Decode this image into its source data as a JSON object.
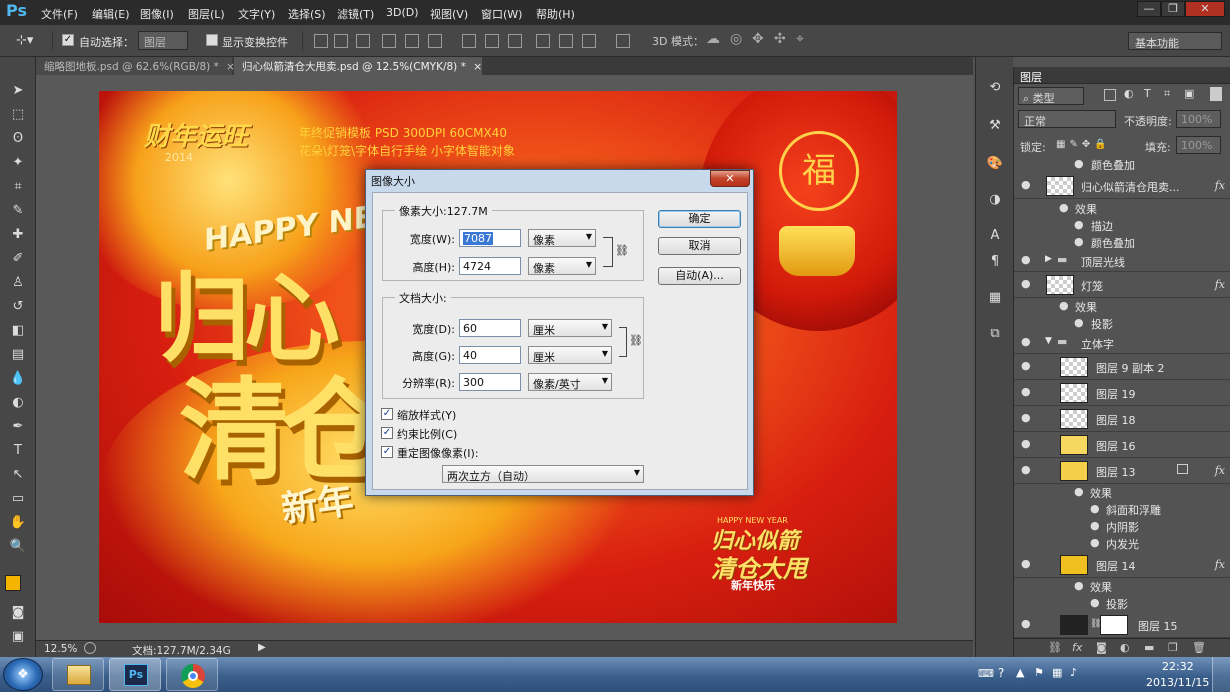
{
  "app": {
    "logo": "Ps"
  },
  "menu": [
    "文件(F)",
    "编辑(E)",
    "图像(I)",
    "图层(L)",
    "文字(Y)",
    "选择(S)",
    "滤镜(T)",
    "3D(D)",
    "视图(V)",
    "窗口(W)",
    "帮助(H)"
  ],
  "window_controls": {
    "minimize": "—",
    "restore": "❐",
    "close": "✕"
  },
  "options": {
    "auto_select_label": "自动选择：",
    "auto_select_value": "图层",
    "show_transform_label": "显示变换控件",
    "mode_3d_label": "3D 模式：",
    "workspace": "基本功能"
  },
  "tabs": [
    {
      "label": "缩略图地板.psd @ 62.6%(RGB/8) *",
      "close": "×"
    },
    {
      "label": "归心似箭清仓大甩卖.psd @ 12.5%(CMYK/8) *",
      "close": "×"
    }
  ],
  "poster": {
    "logo_text": "财年运旺",
    "year": "2014",
    "promo_line1": "年终促销模板 PSD 300DPI   60CMX40",
    "promo_line2": "花朵\\灯笼\\字体自行手绘 小字体智能对象",
    "happy_new": "HAPPY NEW",
    "big_char1": "归心",
    "big_char2": "清仓",
    "new_year": "新年",
    "lantern_char": "福",
    "small_hny": "HAPPY NEW YEAR",
    "small_title1": "归心似箭",
    "small_title2": "清仓大甩",
    "small_newyear": "新年快乐"
  },
  "status": {
    "zoom": "12.5%",
    "doc": "文档:127.7M/2.34G"
  },
  "colors": {
    "foreground": "#f5b400",
    "background": "#ffffff",
    "selected_field": "#3a78d6"
  },
  "dialog": {
    "title": "图像大小",
    "close": "✕",
    "pixel_size_label": "像素大小:127.7M",
    "width_label": "宽度(W):",
    "width_value": "7087",
    "width_unit": "像素",
    "height_label": "高度(H):",
    "height_value": "4724",
    "height_unit": "像素",
    "doc_size_label": "文档大小:",
    "doc_width_label": "宽度(D):",
    "doc_width_value": "60",
    "doc_width_unit": "厘米",
    "doc_height_label": "高度(G):",
    "doc_height_value": "40",
    "doc_height_unit": "厘米",
    "resolution_label": "分辨率(R):",
    "resolution_value": "300",
    "resolution_unit": "像素/英寸",
    "scale_styles": "缩放样式(Y)",
    "constrain": "约束比例(C)",
    "resample": "重定图像像素(I):",
    "resample_method": "两次立方（自动）",
    "ok": "确定",
    "cancel": "取消",
    "auto": "自动(A)..."
  },
  "layers": {
    "panel_title": "图层",
    "kind_filter": "类型",
    "blend_mode": "正常",
    "opacity_label": "不透明度:",
    "opacity_value": "100%",
    "lock_label": "锁定:",
    "fill_label": "填充:",
    "fill_value": "100%",
    "top_effect": "颜色叠加",
    "rows": [
      {
        "name": "归心似箭清仓甩卖...",
        "fx": "fx"
      },
      {
        "name": "顶层光线"
      },
      {
        "name": "灯笼",
        "fx": "fx"
      },
      {
        "name": "立体字"
      },
      {
        "name": "图层 9 副本 2"
      },
      {
        "name": "图层 19"
      },
      {
        "name": "图层 18"
      },
      {
        "name": "图层 16"
      },
      {
        "name": "图层 13",
        "fx": "fx"
      },
      {
        "name": "图层 14",
        "fx": "fx"
      },
      {
        "name": "图层 15"
      }
    ],
    "effects_label": "效果",
    "effect_stroke": "描边",
    "effect_color_overlay": "颜色叠加",
    "effect_drop_shadow": "投影",
    "effect_bevel": "斜面和浮雕",
    "effect_inner_shadow": "内阴影",
    "effect_inner_glow": "内发光"
  },
  "taskbar": {
    "time": "22:32",
    "date": "2013/11/15"
  }
}
